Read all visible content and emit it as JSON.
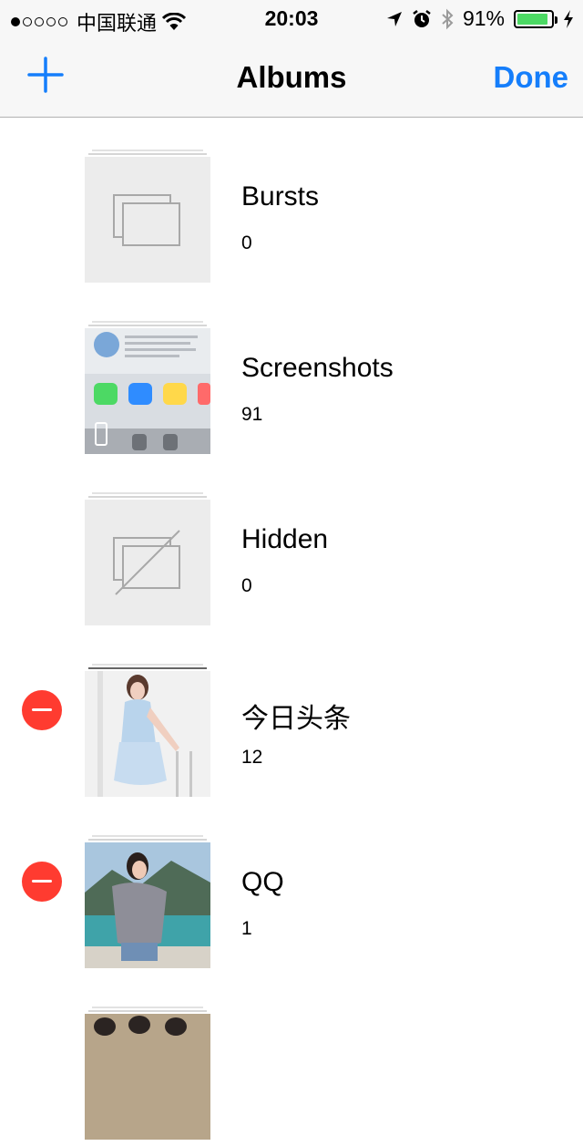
{
  "status_bar": {
    "carrier": "中国联通",
    "time": "20:03",
    "battery": "91%",
    "battery_level": 0.91
  },
  "nav": {
    "title": "Albums",
    "done_label": "Done",
    "add_icon": "plus-icon"
  },
  "albums": [
    {
      "name": "Bursts",
      "count": "0",
      "thumb": "bursts-placeholder-icon",
      "deletable": false
    },
    {
      "name": "Screenshots",
      "count": "91",
      "thumb": "screenshot-photo",
      "deletable": false
    },
    {
      "name": "Hidden",
      "count": "0",
      "thumb": "hidden-placeholder-icon",
      "deletable": false
    },
    {
      "name": "今日头条",
      "count": "12",
      "thumb": "photo",
      "deletable": true
    },
    {
      "name": "QQ",
      "count": "1",
      "thumb": "photo",
      "deletable": true
    }
  ],
  "colors": {
    "accent": "#157efb",
    "delete": "#ff3b30",
    "battery": "#4cd964"
  }
}
